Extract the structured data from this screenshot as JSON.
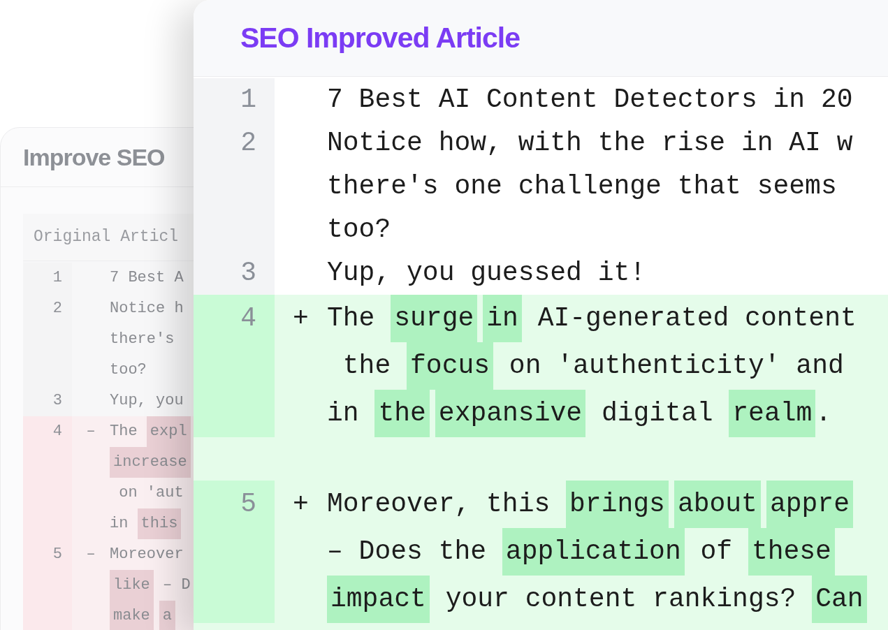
{
  "back_panel": {
    "title": "Improve SEO",
    "editor": {
      "header": "Original Articl",
      "lines": [
        {
          "number": "1",
          "kind": "same",
          "rows": [
            {
              "segments": [
                {
                  "text": "7 Best A",
                  "highlight": false
                }
              ]
            }
          ]
        },
        {
          "number": "2",
          "kind": "same",
          "rows": [
            {
              "segments": [
                {
                  "text": "Notice h",
                  "highlight": false
                }
              ]
            },
            {
              "segments": [
                {
                  "text": "there's",
                  "highlight": false
                }
              ]
            },
            {
              "segments": [
                {
                  "text": "too?",
                  "highlight": false
                }
              ]
            }
          ]
        },
        {
          "number": "3",
          "kind": "same",
          "rows": [
            {
              "segments": [
                {
                  "text": "Yup, you",
                  "highlight": false
                }
              ]
            }
          ]
        },
        {
          "number": "4",
          "kind": "removed",
          "marker": "–",
          "rows": [
            {
              "segments": [
                {
                  "text": "The ",
                  "highlight": false
                },
                {
                  "text": "expl",
                  "highlight": true
                }
              ]
            },
            {
              "segments": [
                {
                  "text": "increase",
                  "highlight": true
                }
              ]
            },
            {
              "segments": [
                {
                  "text": " on 'aut",
                  "highlight": false
                }
              ]
            },
            {
              "segments": [
                {
                  "text": "in ",
                  "highlight": false
                },
                {
                  "text": "this",
                  "highlight": true
                }
              ]
            }
          ]
        },
        {
          "number": "5",
          "kind": "removed",
          "marker": "–",
          "rows": [
            {
              "segments": [
                {
                  "text": "Moreover",
                  "highlight": false
                }
              ]
            },
            {
              "segments": [
                {
                  "text": "like",
                  "highlight": true
                },
                {
                  "text": " – D",
                  "highlight": false
                }
              ]
            },
            {
              "segments": [
                {
                  "text": "make",
                  "highlight": true
                },
                {
                  "text": "a",
                  "highlight": true
                }
              ]
            }
          ]
        }
      ]
    }
  },
  "front_panel": {
    "title": "SEO Improved Article",
    "lines": [
      {
        "number": "1",
        "kind": "same",
        "rows": [
          {
            "segments": [
              {
                "text": "7 Best AI Content Detectors in 20",
                "highlight": false
              }
            ]
          }
        ]
      },
      {
        "number": "2",
        "kind": "same",
        "rows": [
          {
            "segments": [
              {
                "text": "Notice how, with the rise in AI w",
                "highlight": false
              }
            ]
          },
          {
            "segments": [
              {
                "text": "there's one challenge that seems",
                "highlight": false
              }
            ]
          },
          {
            "segments": [
              {
                "text": "too?",
                "highlight": false
              }
            ]
          }
        ]
      },
      {
        "number": "3",
        "kind": "same",
        "rows": [
          {
            "segments": [
              {
                "text": "Yup, you guessed it!",
                "highlight": false
              }
            ]
          }
        ]
      },
      {
        "number": "4",
        "kind": "added",
        "marker": "+",
        "rows": [
          {
            "segments": [
              {
                "text": "The ",
                "highlight": false
              },
              {
                "text": "surge",
                "highlight": true
              },
              {
                "text": "in",
                "highlight": true
              },
              {
                "text": " AI-generated content",
                "highlight": false
              }
            ]
          },
          {
            "segments": [
              {
                "text": " the ",
                "highlight": false
              },
              {
                "text": "focus",
                "highlight": true
              },
              {
                "text": " on 'authenticity' and",
                "highlight": false
              }
            ]
          },
          {
            "segments": [
              {
                "text": "in ",
                "highlight": false
              },
              {
                "text": "the",
                "highlight": true
              },
              {
                "text": "expansive",
                "highlight": true
              },
              {
                "text": " digital ",
                "highlight": false
              },
              {
                "text": "realm",
                "highlight": true
              },
              {
                "text": ".",
                "highlight": false
              }
            ]
          }
        ]
      },
      {
        "number": "5",
        "kind": "added",
        "marker": "+",
        "rows": [
          {
            "segments": [
              {
                "text": "Moreover, this ",
                "highlight": false
              },
              {
                "text": "brings",
                "highlight": true
              },
              {
                "text": "about",
                "highlight": true
              },
              {
                "text": "appre",
                "highlight": true
              }
            ]
          },
          {
            "segments": [
              {
                "text": "– Does the ",
                "highlight": false
              },
              {
                "text": "application",
                "highlight": true
              },
              {
                "text": " of ",
                "highlight": false
              },
              {
                "text": "these",
                "highlight": true
              }
            ]
          },
          {
            "segments": [
              {
                "text": "impact",
                "highlight": true
              },
              {
                "text": " your content rankings? ",
                "highlight": false
              },
              {
                "text": "Can",
                "highlight": true
              }
            ]
          }
        ]
      }
    ]
  }
}
